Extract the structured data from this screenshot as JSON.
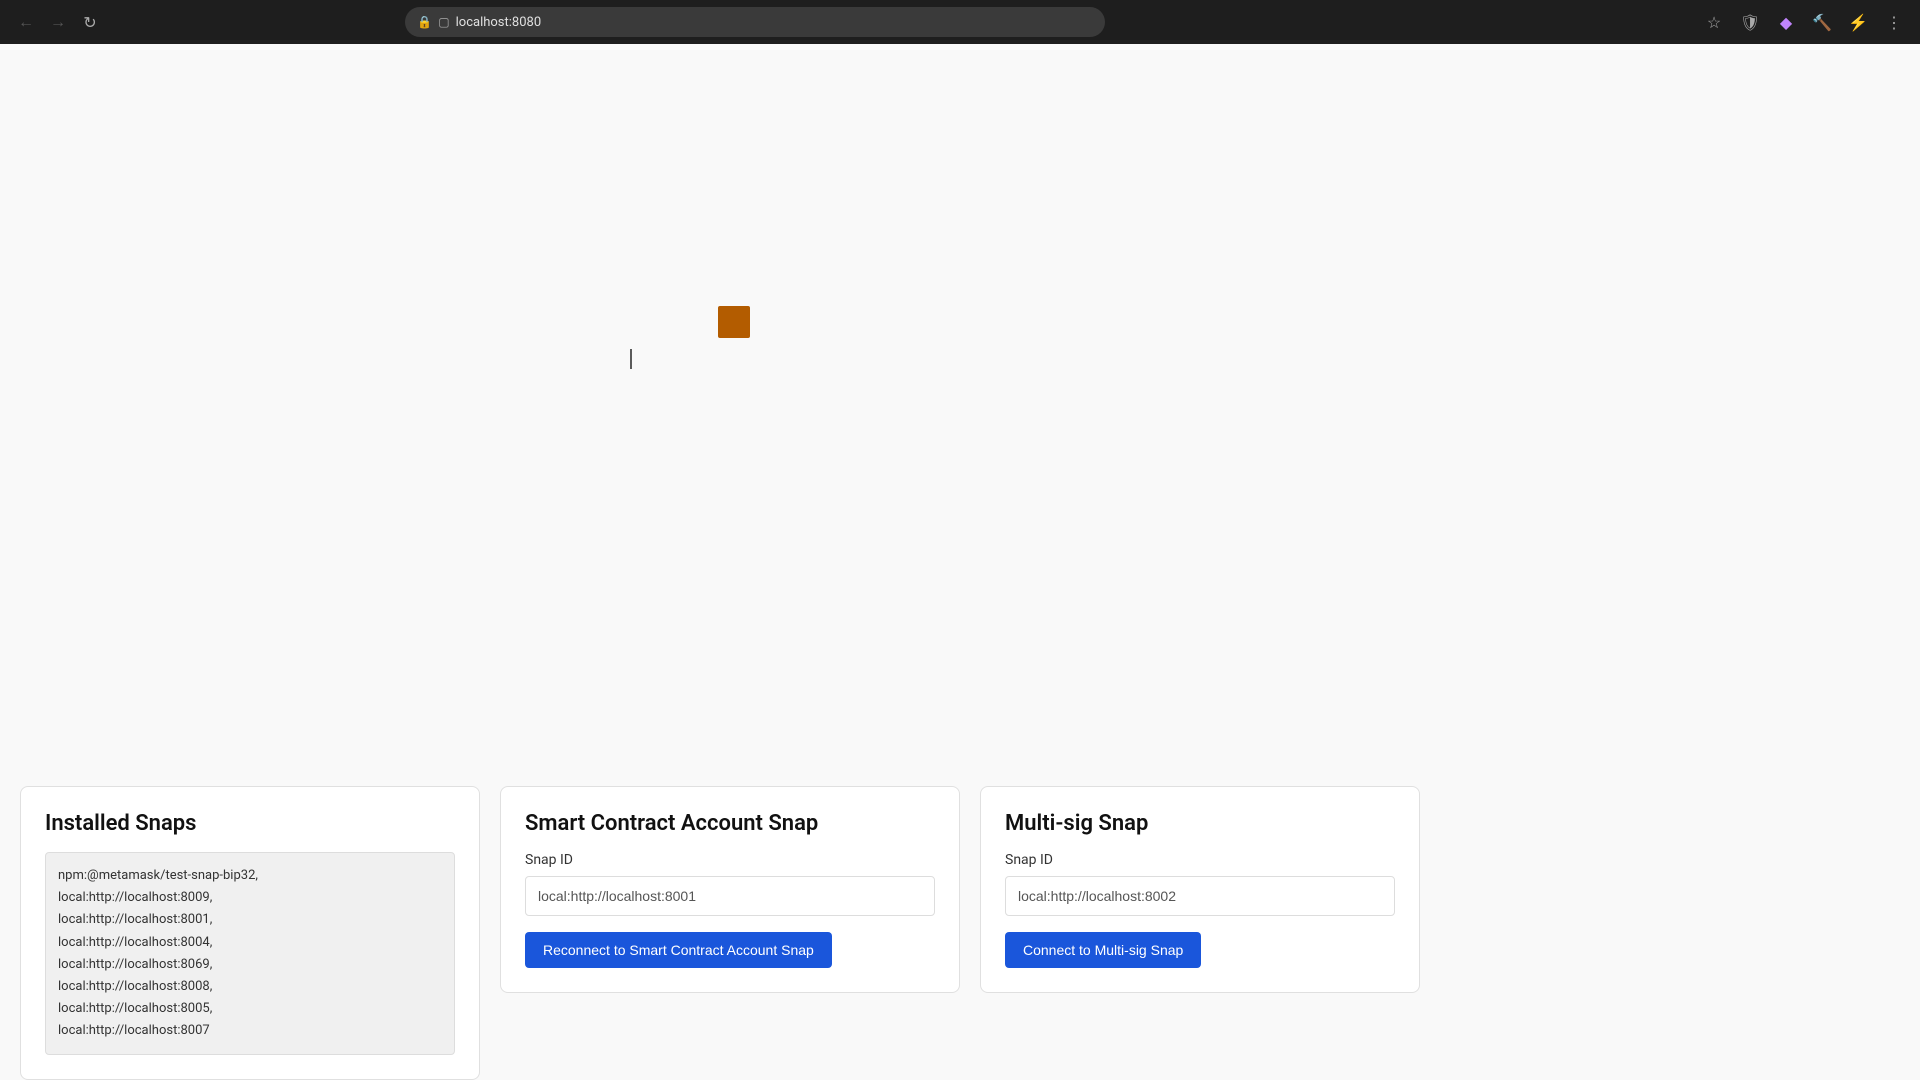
{
  "browser": {
    "url": "localhost:8080",
    "nav": {
      "back_disabled": true,
      "forward_disabled": true
    }
  },
  "installed_snaps": {
    "title": "Installed Snaps",
    "list": "npm:@metamask/test-snap-bip32,\nlocal:http://localhost:8009,\nlocal:http://localhost:8001,\nlocal:http://localhost:8004,\nlocal:http://localhost:8069,\nlocal:http://localhost:8008,\nlocal:http://localhost:8005,\nlocal:http://localhost:8007"
  },
  "smart_contract_panel": {
    "title": "Smart Contract Account Snap",
    "snap_id_label": "Snap ID",
    "snap_id_value": "local:http://localhost:8001",
    "reconnect_button": "Reconnect to Smart Contract Account Snap"
  },
  "multisig_panel": {
    "title": "Multi-sig Snap",
    "snap_id_label": "Snap ID",
    "snap_id_value": "local:http://localhost:8002",
    "connect_button": "Connect to Multi-sig Snap"
  }
}
